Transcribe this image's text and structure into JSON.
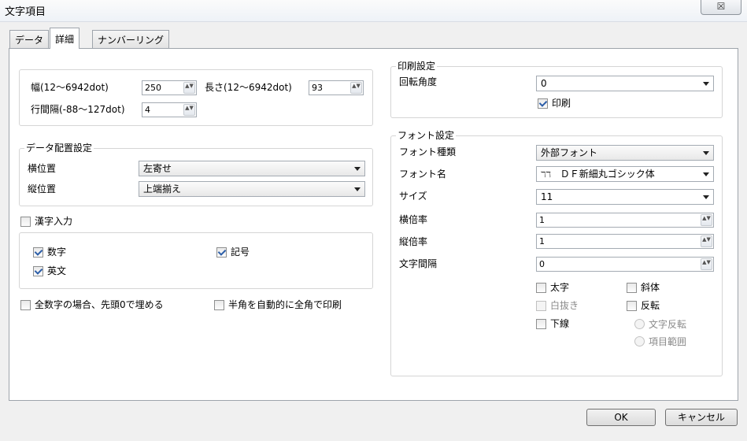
{
  "window": {
    "title": "文字項目",
    "close_glyph": "☒"
  },
  "tabs": [
    {
      "label": "データ"
    },
    {
      "label": "詳細"
    },
    {
      "label": "ナンバーリング"
    }
  ],
  "size": {
    "width_label": "幅(12〜6942dot)",
    "width_value": "250",
    "length_label": "長さ(12〜6942dot)",
    "length_value": "93",
    "line_spacing_label": "行間隔(-88〜127dot)",
    "line_spacing_value": "4",
    "spin_glyph": "▲▼"
  },
  "data_layout": {
    "title": "データ配置設定",
    "horizontal_label": "横位置",
    "horizontal_value": "左寄せ",
    "vertical_label": "縦位置",
    "vertical_value": "上端揃え"
  },
  "kanji_input": {
    "label": "漢字入力",
    "checked": false
  },
  "char_types": {
    "digits": {
      "label": "数字",
      "checked": true
    },
    "symbols": {
      "label": "記号",
      "checked": true
    },
    "alpha": {
      "label": "英文",
      "checked": true
    }
  },
  "options": {
    "zero_fill": {
      "label": "全数字の場合、先頭0で埋める",
      "checked": false
    },
    "fullwidth": {
      "label": "半角を自動的に全角で印刷",
      "checked": false
    }
  },
  "print_settings": {
    "title": "印刷設定",
    "rotation_label": "回転角度",
    "rotation_value": "0",
    "print": {
      "label": "印刷",
      "checked": true
    }
  },
  "font_settings": {
    "title": "フォント設定",
    "type_label": "フォント種類",
    "type_value": "外部フォント",
    "name_label": "フォント名",
    "name_value": "ＤＦ新細丸ゴシック体",
    "name_glyph": "ℸℸ",
    "size_label": "サイズ",
    "size_value": "11",
    "hscale_label": "横倍率",
    "hscale_value": "1",
    "vscale_label": "縦倍率",
    "vscale_value": "1",
    "spacing_label": "文字間隔",
    "spacing_value": "0"
  },
  "styles": {
    "bold": {
      "label": "太字",
      "checked": false
    },
    "italic": {
      "label": "斜体",
      "checked": false
    },
    "outline": {
      "label": "白抜き",
      "checked": false,
      "disabled": true
    },
    "invert": {
      "label": "反転",
      "checked": false
    },
    "underline": {
      "label": "下線",
      "checked": false
    },
    "invert_text": {
      "label": "文字反転",
      "disabled": true
    },
    "invert_area": {
      "label": "項目範囲",
      "disabled": true
    }
  },
  "buttons": {
    "ok": "OK",
    "cancel": "キャンセル"
  }
}
